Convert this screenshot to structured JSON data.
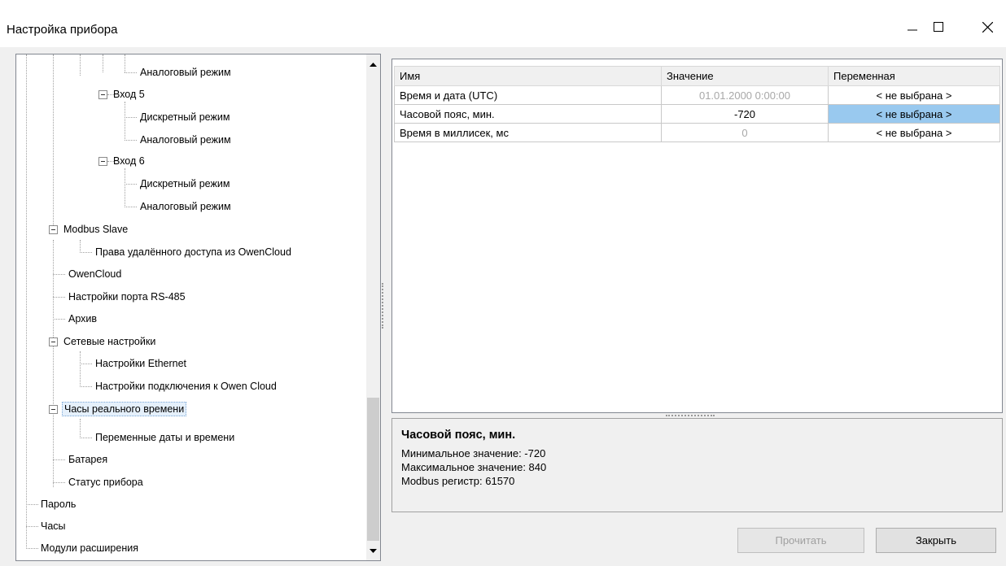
{
  "window": {
    "title": "Настройка прибора"
  },
  "tree": {
    "items": [
      "Аналоговый режим",
      "Вход 5",
      "Дискретный режим",
      "Аналоговый режим",
      "Вход 6",
      "Дискретный режим",
      "Аналоговый режим",
      "Modbus Slave",
      "Права удалённого доступа из OwenCloud",
      "OwenCloud",
      "Настройки порта RS-485",
      "Архив",
      "Сетевые настройки",
      "Настройки Ethernet",
      "Настройки подключения к Owen Cloud",
      "Часы реального времени",
      "Переменные даты и времени",
      "Батарея",
      "Статус прибора",
      "Пароль",
      "Часы",
      "Модули расширения"
    ],
    "selected": "Часы реального времени"
  },
  "grid": {
    "headers": [
      "Имя",
      "Значение",
      "Переменная"
    ],
    "rows": [
      {
        "name": "Время и дата (UTC)",
        "value": "01.01.2000 0:00:00",
        "variable": "< не выбрана >"
      },
      {
        "name": "Часовой пояс, мин.",
        "value": "-720",
        "variable": "< не выбрана >"
      },
      {
        "name": "Время в миллисек, мс",
        "value": "0",
        "variable": "< не выбрана >"
      }
    ]
  },
  "description": {
    "title": "Часовой пояс, мин.",
    "lines": [
      "Минимальное значение: -720",
      "Максимальное значение: 840",
      "Modbus регистр: 61570"
    ]
  },
  "buttons": {
    "read": "Прочитать",
    "close": "Закрыть"
  },
  "colors": {
    "highlight": "#99c9ef",
    "selection": "#e5f0fb"
  }
}
